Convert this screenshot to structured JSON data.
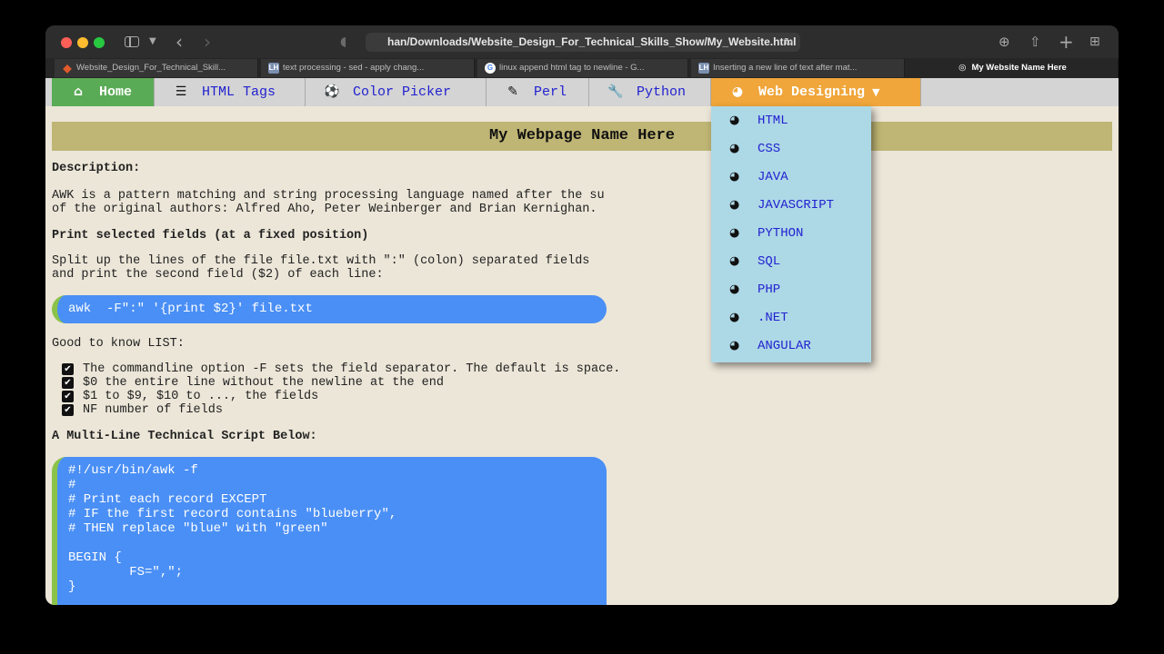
{
  "browser": {
    "url": "han/Downloads/Website_Design_For_Technical_Skills_Show/My_Website.html",
    "tabs": [
      {
        "title": "Website_Design_For_Technical_Skill...",
        "favicon": "diamond"
      },
      {
        "title": "text processing - sed - apply chang...",
        "favicon": "lh"
      },
      {
        "title": "linux append html tag to newline - G...",
        "favicon": "google"
      },
      {
        "title": "Inserting a new line of text after mat...",
        "favicon": "lh"
      },
      {
        "title": "My Website Name Here",
        "favicon": "compass",
        "active": true
      }
    ],
    "favicon_labels": {
      "lh": "LH",
      "google": "G"
    }
  },
  "nav": {
    "items": [
      {
        "label": "Home",
        "icon": "home-icon",
        "glyph": "⌂"
      },
      {
        "label": "HTML Tags",
        "icon": "list-icon",
        "glyph": "☰"
      },
      {
        "label": "Color Picker",
        "icon": "soccer-ball-icon",
        "glyph": "⚽"
      },
      {
        "label": "Perl",
        "icon": "edit-icon",
        "glyph": "✎"
      },
      {
        "label": "Python",
        "icon": "wrench-icon",
        "glyph": "🔧"
      },
      {
        "label": "Web Designing",
        "icon": "globe-icon",
        "glyph": "◕"
      }
    ],
    "dropdown": [
      "HTML",
      "CSS",
      "JAVA",
      "JAVASCRIPT",
      "PYTHON",
      "SQL",
      "PHP",
      ".NET",
      "ANGULAR"
    ]
  },
  "page": {
    "title": "My Webpage Name Here",
    "description_heading": "Description:",
    "description_line1": "AWK is a pattern matching and string processing language named after the su",
    "description_line2": "of the original authors: Alfred Aho, Peter Weinberger and Brian Kernighan.",
    "section1_heading": "Print selected fields (at a fixed position)",
    "section1_line1": "Split up the lines of the file file.txt with \":\" (colon) separated fields",
    "section1_line2": "and print the second field ($2) of each line:",
    "code_example": "awk  -F\":\" '{print $2}' file.txt",
    "list_heading": "Good to know LIST:",
    "list_items": [
      "The commandline option -F sets the field separator. The default is space.",
      "$0 the entire line without the newline at the end",
      "$1 to $9, $10 to ..., the fields",
      "NF number of fields"
    ],
    "script_heading": "A Multi-Line Technical Script Below:",
    "script_lines": [
      "#!/usr/bin/awk -f",
      "#",
      "# Print each record EXCEPT",
      "# IF the first record contains \"blueberry\",",
      "# THEN replace \"blue\" with \"green\"",
      "",
      "BEGIN {",
      "        FS=\",\";",
      "}"
    ]
  }
}
